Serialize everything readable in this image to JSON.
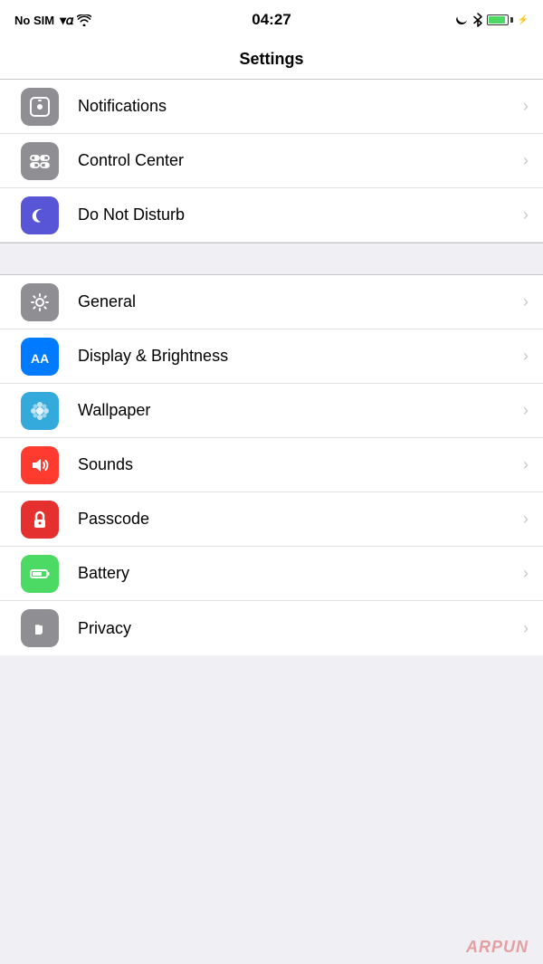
{
  "statusBar": {
    "carrier": "No SIM",
    "time": "04:27",
    "batteryPercent": 90
  },
  "navBar": {
    "title": "Settings"
  },
  "groups": [
    {
      "id": "group1",
      "items": [
        {
          "id": "notifications",
          "label": "Notifications",
          "iconColor": "gray",
          "iconType": "notifications"
        },
        {
          "id": "control-center",
          "label": "Control Center",
          "iconColor": "gray",
          "iconType": "control-center"
        },
        {
          "id": "do-not-disturb",
          "label": "Do Not Disturb",
          "iconColor": "purple",
          "iconType": "do-not-disturb"
        }
      ]
    },
    {
      "id": "group2",
      "items": [
        {
          "id": "general",
          "label": "General",
          "iconColor": "gray",
          "iconType": "general"
        },
        {
          "id": "display-brightness",
          "label": "Display & Brightness",
          "iconColor": "blue",
          "iconType": "display"
        },
        {
          "id": "wallpaper",
          "label": "Wallpaper",
          "iconColor": "cyan",
          "iconType": "wallpaper"
        },
        {
          "id": "sounds",
          "label": "Sounds",
          "iconColor": "red",
          "iconType": "sounds"
        },
        {
          "id": "passcode",
          "label": "Passcode",
          "iconColor": "red2",
          "iconType": "passcode"
        },
        {
          "id": "battery",
          "label": "Battery",
          "iconColor": "green",
          "iconType": "battery"
        },
        {
          "id": "privacy",
          "label": "Privacy",
          "iconColor": "dark-gray",
          "iconType": "privacy"
        }
      ]
    }
  ],
  "watermark": "ARPUN"
}
